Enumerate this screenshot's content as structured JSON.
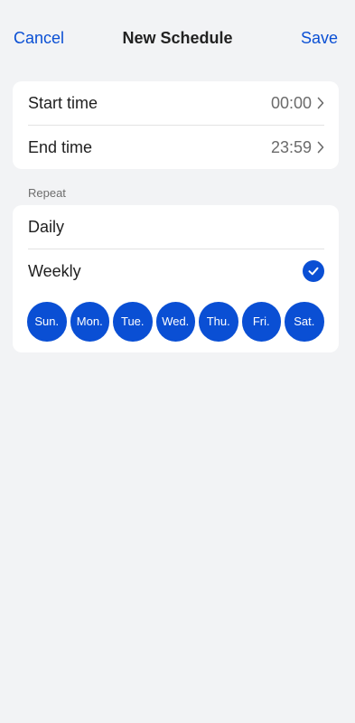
{
  "header": {
    "cancel_label": "Cancel",
    "title": "New Schedule",
    "save_label": "Save"
  },
  "time": {
    "start_label": "Start time",
    "start_value": "00:00",
    "end_label": "End time",
    "end_value": "23:59"
  },
  "repeat": {
    "section_label": "Repeat",
    "options": [
      {
        "label": "Daily",
        "selected": false
      },
      {
        "label": "Weekly",
        "selected": true
      }
    ],
    "days": [
      "Sun.",
      "Mon.",
      "Tue.",
      "Wed.",
      "Thu.",
      "Fri.",
      "Sat."
    ]
  },
  "colors": {
    "accent": "#0a4fd4",
    "background": "#f2f3f5",
    "card": "#ffffff"
  },
  "icons": {
    "chevron": "chevron-right-icon",
    "check": "checkmark-circle-icon"
  }
}
